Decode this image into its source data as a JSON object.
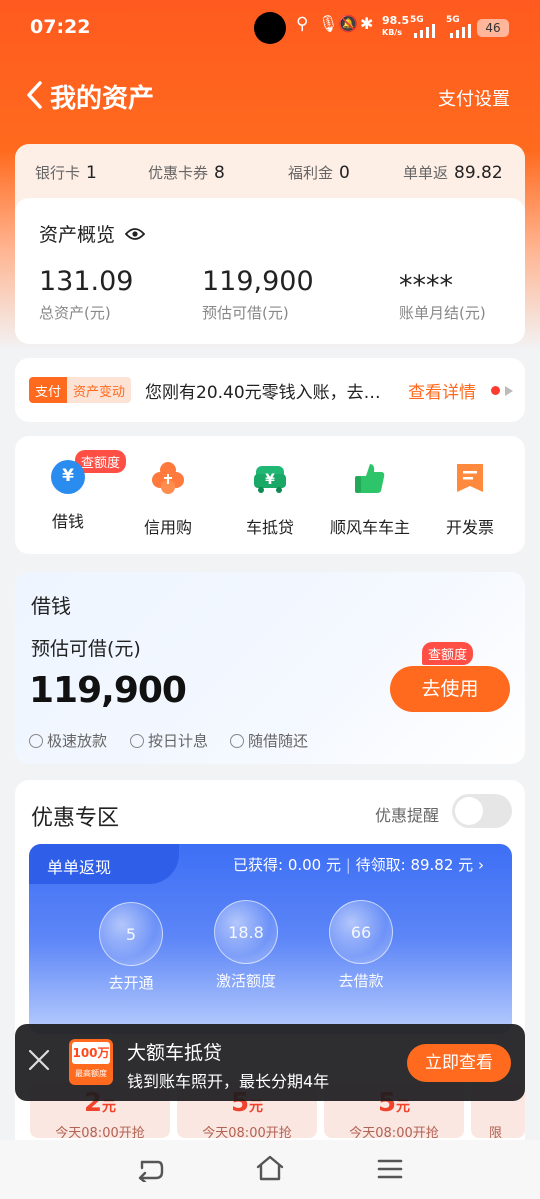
{
  "status_bar": {
    "time": "07:22",
    "speed": "98.5",
    "speed_unit": "KB/s",
    "battery": "46",
    "net1": "5G",
    "net2": "5G"
  },
  "nav": {
    "title": "我的资产",
    "settings": "支付设置"
  },
  "stats": [
    {
      "label": "银行卡",
      "value": "1"
    },
    {
      "label": "优惠卡券",
      "value": "8"
    },
    {
      "label": "福利金",
      "value": "0"
    },
    {
      "label": "单单返",
      "value": "89.82"
    }
  ],
  "assets": {
    "title": "资产概览",
    "items": [
      {
        "value": "131.09",
        "label": "总资产(元)"
      },
      {
        "value": "119,900",
        "label": "预估可借(元)"
      },
      {
        "value": "****",
        "label": "账单月结(元)"
      }
    ]
  },
  "notice": {
    "tag1": "支付",
    "tag2": "资产变动",
    "text": "您刚有20.40元零钱入账，去…",
    "link": "查看详情"
  },
  "quick": {
    "badge": "查额度",
    "items": [
      {
        "label": "借钱",
        "icon": "yuan-coin-icon"
      },
      {
        "label": "信用购",
        "icon": "clover-icon"
      },
      {
        "label": "车抵贷",
        "icon": "car-yuan-icon"
      },
      {
        "label": "顺风车车主",
        "icon": "thumbs-up-icon"
      },
      {
        "label": "开发票",
        "icon": "invoice-icon"
      }
    ]
  },
  "loan": {
    "title": "借钱",
    "subtitle": "预估可借(元)",
    "amount": "119,900",
    "button": "去使用",
    "badge": "查额度",
    "features": [
      "极速放款",
      "按日计息",
      "随借随还"
    ]
  },
  "promo": {
    "title": "优惠专区",
    "remind": "优惠提醒",
    "cashback_tab": "单单返现",
    "earned": "已获得: 0.00 元",
    "separator": "|",
    "pending": "待领取: 89.82 元",
    "bubbles": [
      {
        "value": "5",
        "label": "去开通"
      },
      {
        "value": "18.8",
        "label": "激活额度"
      },
      {
        "value": "66",
        "label": "去借款"
      }
    ]
  },
  "coupons": [
    {
      "value": "2",
      "unit": "元",
      "note": "今天08:00开抢"
    },
    {
      "value": "5",
      "unit": "元",
      "note": "今天08:00开抢"
    },
    {
      "value": "5",
      "unit": "元",
      "note": "今天08:00开抢"
    },
    {
      "value": "",
      "unit": "",
      "note": "限"
    }
  ],
  "toast": {
    "logo_top": "100万",
    "logo_bottom": "最高额度",
    "title": "大额车抵贷",
    "subtitle": "钱到账车照开，最长分期4年",
    "button": "立即查看"
  },
  "colors": {
    "brand": "#ff6a1e",
    "badge": "#ff4f45",
    "blue": "#3d6ff5"
  }
}
